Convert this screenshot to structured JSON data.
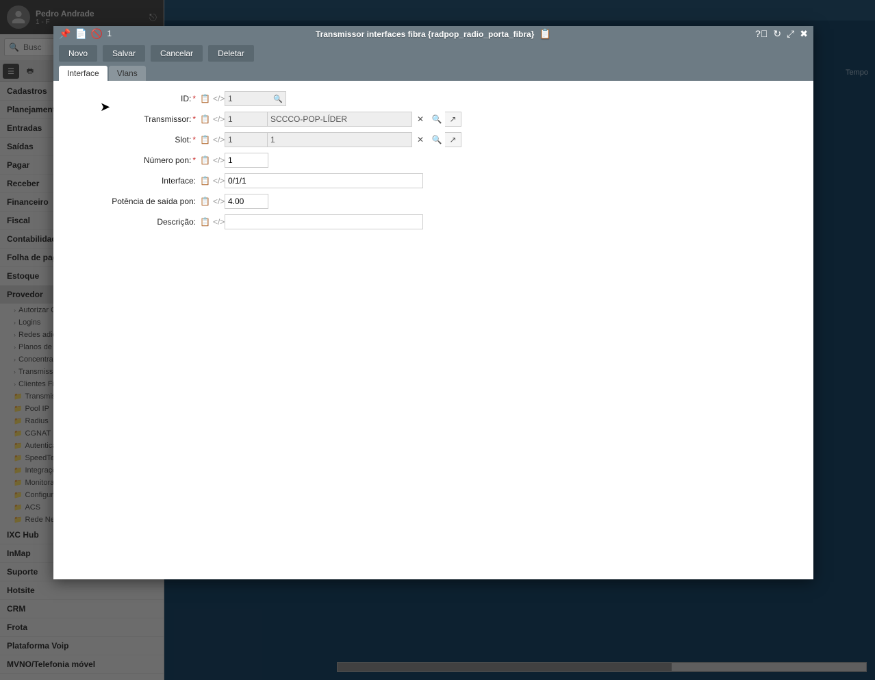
{
  "user": {
    "name": "Pedro Andrade",
    "subtitle": "1 - F"
  },
  "search": {
    "placeholder": "Busc"
  },
  "sidebar_menu": [
    "Cadastros",
    "Planejamento",
    "Entradas",
    "Saídas",
    "Pagar",
    "Receber",
    "Financeiro",
    "Fiscal",
    "Contabilidade",
    "Folha de pagamento",
    "Estoque",
    "Provedor"
  ],
  "sidebar_sub": [
    {
      "type": "chev",
      "label": "Autorizar O"
    },
    {
      "type": "chev",
      "label": "Logins"
    },
    {
      "type": "chev",
      "label": "Redes adic"
    },
    {
      "type": "chev",
      "label": "Planos de v"
    },
    {
      "type": "chev",
      "label": "Concentrado"
    },
    {
      "type": "chev",
      "label": "Transmissor"
    },
    {
      "type": "chev",
      "label": "Clientes Fib"
    },
    {
      "type": "folder",
      "label": "Transmisso"
    },
    {
      "type": "folder",
      "label": "Pool IP"
    },
    {
      "type": "folder",
      "label": "Radius"
    },
    {
      "type": "folder",
      "label": "CGNAT"
    },
    {
      "type": "folder",
      "label": "Autenticaç"
    },
    {
      "type": "folder",
      "label": "SpeedTest"
    },
    {
      "type": "folder",
      "label": "Integraçõe"
    },
    {
      "type": "folder",
      "label": "Monitoram"
    },
    {
      "type": "folder",
      "label": "Configuraç"
    },
    {
      "type": "folder",
      "label": "ACS"
    },
    {
      "type": "folder",
      "label": "Rede Neut"
    }
  ],
  "sidebar_menu2": [
    "IXC Hub",
    "InMap",
    "Suporte",
    "Hotsite",
    "CRM",
    "Frota",
    "Plataforma Voip",
    "MVNO/Telefonia móvel"
  ],
  "tempo_label": "Tempo",
  "dialog": {
    "title": "Transmissor interfaces fibra {radpop_radio_porta_fibra}",
    "count": "1",
    "buttons": {
      "novo": "Novo",
      "salvar": "Salvar",
      "cancelar": "Cancelar",
      "deletar": "Deletar"
    },
    "tabs": {
      "interface": "Interface",
      "vlans": "Vlans"
    },
    "form": {
      "id_label": "ID:",
      "id_value": "1",
      "trans_label": "Transmissor:",
      "trans_code": "1",
      "trans_desc": "SCCCO-POP-LÍDER",
      "slot_label": "Slot:",
      "slot_code": "1",
      "slot_desc": "1",
      "pon_label": "Número pon:",
      "pon_value": "1",
      "iface_label": "Interface:",
      "iface_value": "0/1/1",
      "pot_label": "Potência de saída pon:",
      "pot_value": "4.00",
      "desc_label": "Descrição:",
      "desc_value": ""
    }
  }
}
